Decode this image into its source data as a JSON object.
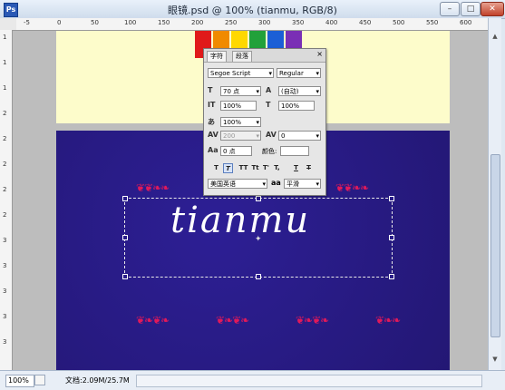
{
  "window": {
    "title": "眼镜.psd @ 100% (tianmu, RGB/8)",
    "app_icon_letters": "Ps",
    "buttons": {
      "minimize": "–",
      "maximize": "□",
      "close": "✕"
    }
  },
  "rulers": {
    "top_ticks": [
      "-5",
      "0",
      "50",
      "100",
      "150",
      "200",
      "250",
      "300",
      "350",
      "400",
      "450",
      "500",
      "550",
      "600"
    ],
    "left_ticks": [
      "1",
      "1",
      "1",
      "2",
      "2",
      "2",
      "2",
      "2",
      "3",
      "3",
      "3",
      "3",
      "3"
    ]
  },
  "canvas": {
    "text_layer": "tianmu",
    "colors": {
      "top_band": "#fdfccb",
      "bottom_band": "#251882",
      "text": "#ffffff",
      "ornament": "#e0195a"
    },
    "logo_colors": [
      "#e01a1a",
      "#f08a00",
      "#ffd800",
      "#22a13a",
      "#1b5fd6",
      "#7a2fb5"
    ]
  },
  "character_panel": {
    "tabs": [
      "字符",
      "段落"
    ],
    "close_icon": "×",
    "font_family": "Segoe Script",
    "font_style": "Regular",
    "font_size": "70 点",
    "leading": "(自动)",
    "vertical_scale": "100%",
    "horizontal_scale": "100%",
    "tsume": "100%",
    "kerning": "200",
    "tracking": "0",
    "baseline_shift": "0 点",
    "color_label": "颜色:",
    "style_buttons": [
      "T",
      "T",
      "TT",
      "Tt",
      "T'",
      "T,",
      "T",
      "T"
    ],
    "language": "美国英语",
    "antialias_icon": "aa",
    "antialias": "平滑"
  },
  "status": {
    "zoom": "100%",
    "doc_info": "文档:2.09M/25.7M"
  }
}
